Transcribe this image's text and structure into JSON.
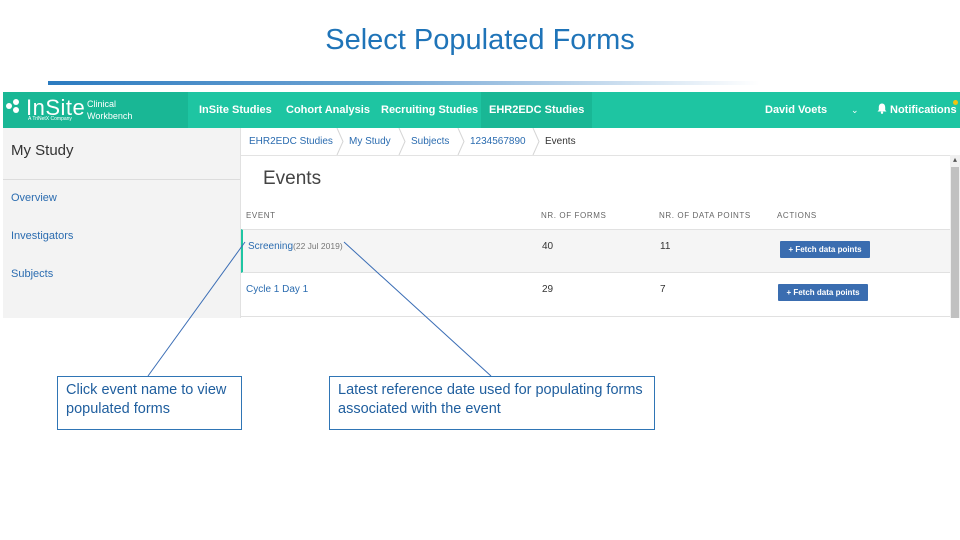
{
  "slide": {
    "title": "Select Populated Forms"
  },
  "app": {
    "logo": {
      "name": "InSite",
      "tagline": "A TriNetX Company",
      "product": "Clinical Workbench"
    },
    "nav": [
      {
        "label": "InSite Studies",
        "active": false
      },
      {
        "label": "Cohort Analysis",
        "active": false
      },
      {
        "label": "Recruiting Studies",
        "active": false
      },
      {
        "label": "EHR2EDC Studies",
        "active": true
      }
    ],
    "user": {
      "name": "David Voets",
      "chevron_icon": "chevron-down-icon"
    },
    "notifications": {
      "label": "Notifications",
      "icon": "bell-icon"
    },
    "colors": {
      "topbar": "#1ec5a2",
      "active_nav": "#19b795",
      "link": "#2b6cb0",
      "button": "#3a6db0"
    }
  },
  "sidebar": {
    "title": "My Study",
    "items": [
      {
        "label": "Overview"
      },
      {
        "label": "Investigators"
      },
      {
        "label": "Subjects"
      }
    ]
  },
  "breadcrumb": [
    {
      "label": "EHR2EDC Studies"
    },
    {
      "label": "My Study"
    },
    {
      "label": "Subjects"
    },
    {
      "label": "1234567890"
    },
    {
      "label": "Events"
    }
  ],
  "events": {
    "heading": "Events",
    "columns": {
      "event": "EVENT",
      "forms": "NR. OF FORMS",
      "data_points": "NR. OF DATA POINTS",
      "actions": "ACTIONS"
    },
    "rows": [
      {
        "name": "Screening",
        "date": "(22 Jul 2019)",
        "forms": "40",
        "data_points": "11",
        "action": "+ Fetch data points"
      },
      {
        "name": "Cycle 1 Day 1",
        "date": "",
        "forms": "29",
        "data_points": "7",
        "action": "+ Fetch data points"
      }
    ]
  },
  "callouts": [
    {
      "text": "Click event name to view populated forms"
    },
    {
      "text": "Latest reference date used for populating forms associated with the event"
    }
  ]
}
